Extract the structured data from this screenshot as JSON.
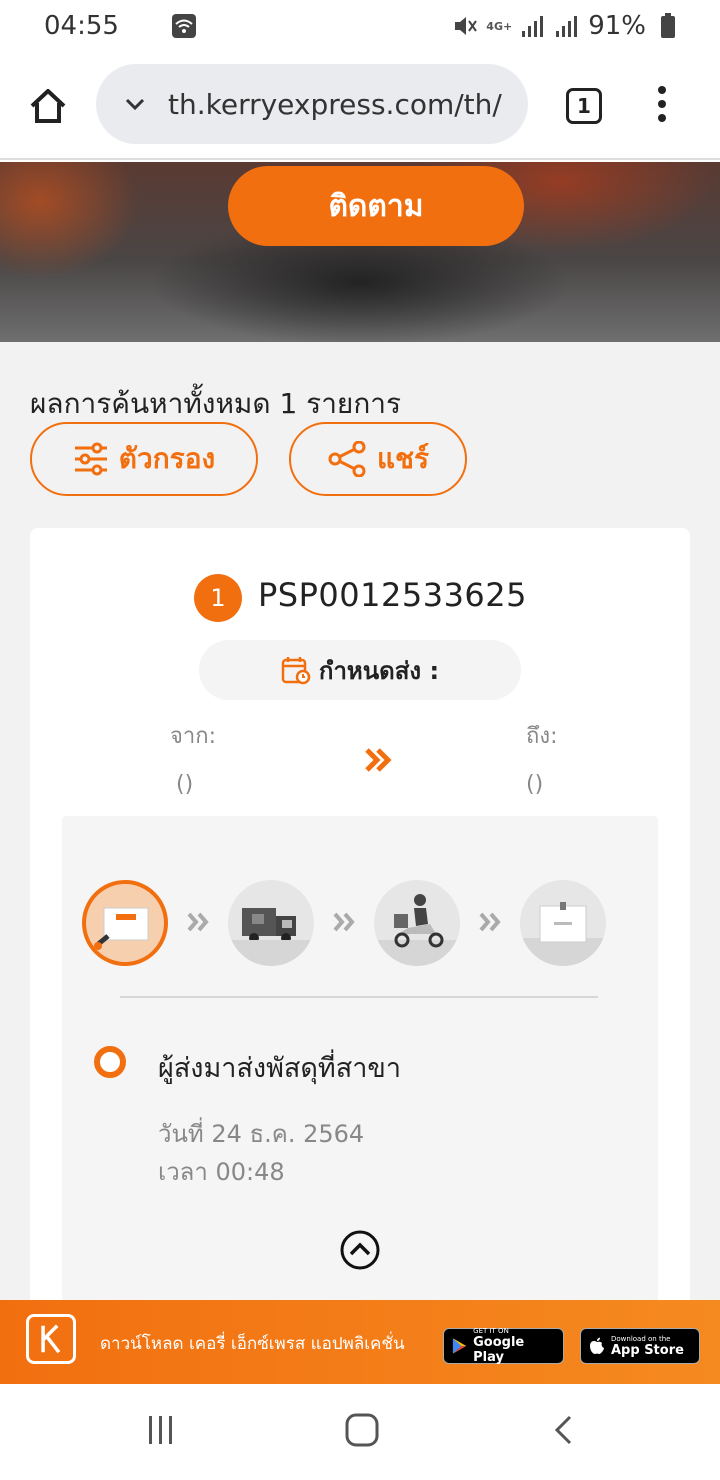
{
  "status_bar": {
    "time": "04:55",
    "network": "4G+",
    "battery": "91%"
  },
  "browser": {
    "url": "th.kerryexpress.com/th/",
    "tab_count": "1",
    "icons": [
      "home-icon",
      "chevron-down-icon",
      "more-vert-icon"
    ]
  },
  "hero": {
    "track_button_label": "ติดตาม"
  },
  "results": {
    "summary": "ผลการค้นหาทั้งหมด 1 รายการ",
    "filter_label": "ตัวกรอง",
    "share_label": "แชร์"
  },
  "shipment": {
    "index": "1",
    "tracking_number": "PSP0012533625",
    "due_label": "กำหนดส่ง :",
    "from_label": "จาก:",
    "from_value": "()",
    "to_label": "ถึง:",
    "to_value": "()",
    "steps": [
      {
        "name": "parcel-dropoff",
        "active": true
      },
      {
        "name": "truck-transit",
        "active": false
      },
      {
        "name": "motorbike-delivery",
        "active": false
      },
      {
        "name": "parcel-delivered",
        "active": false
      }
    ],
    "latest_status": "ผู้ส่งมาส่งพัสดุที่สาขา",
    "latest_date": "วันที่ 24 ธ.ค. 2564",
    "latest_time": "เวลา 00:48"
  },
  "app_banner": {
    "text": "ดาวน์โหลด เคอรี่ เอ็กซ์เพรส แอปพลิเคชั่น",
    "google_play_small": "GET IT ON",
    "google_play_big": "Google Play",
    "app_store_small": "Download on the",
    "app_store_big": "App Store"
  },
  "colors": {
    "brand_orange": "#f26f10",
    "panel_bg": "#f2f2f2"
  }
}
